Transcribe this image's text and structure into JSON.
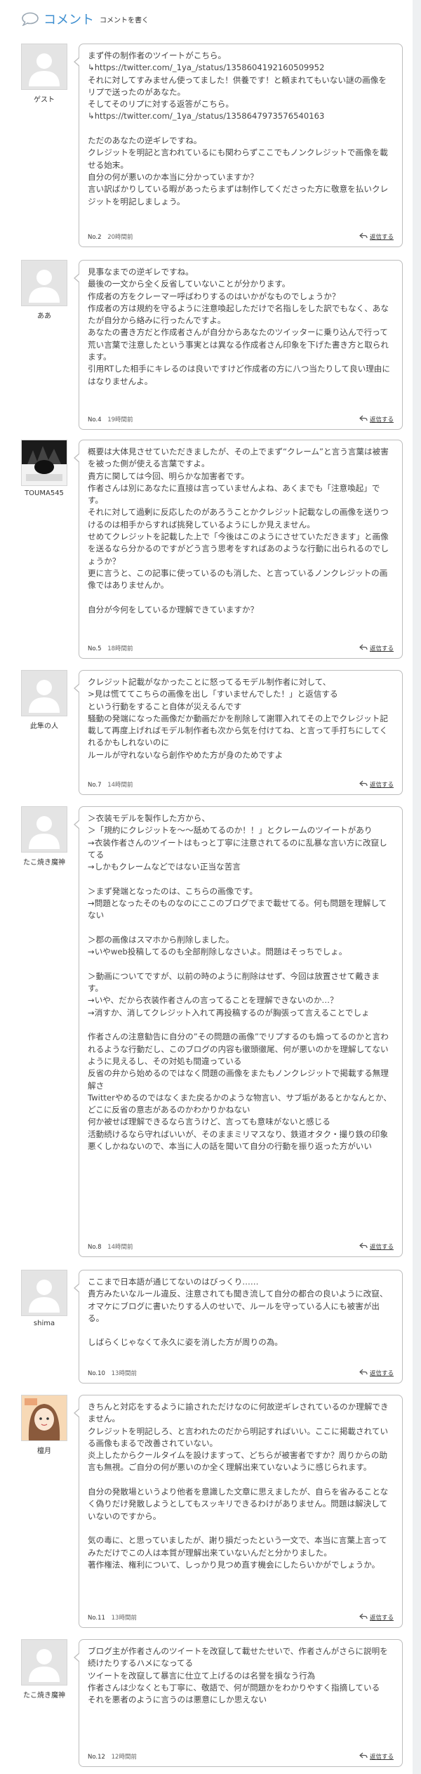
{
  "header": {
    "title": "コメント",
    "write_link": "コメントを書く",
    "accent_color": "#3e8fd0"
  },
  "reply_icon": "reply-arrow-icon",
  "comments": [
    {
      "author": "ゲスト",
      "avatar": "default-avatar",
      "no": "No.2",
      "time": "20時間前",
      "reply": "返信する",
      "body": "まず件の制作者のツイートがこちら。\n↳https://twitter.com/_1ya_/status/1358604192160509952\nそれに対してすみません使ってました！供養です！と頼まれてもいない謎の画像をリプで送ったのがあなた。\nそしてそのリプに対する返答がこちら。\n↳https://twitter.com/_1ya_/status/1358647973576540163\n\nただのあなたの逆ギレですね。\nクレジットを明記と言われているにも関わらずここでもノンクレジットで画像を載せる始末。\n自分の何が悪いのか本当に分かっていますか？\n言い訳ばかりしている暇があったらまずは制作してくださった方に敬意を払いクレジットを明記しましょう。"
    },
    {
      "author": "ああ",
      "avatar": "default-avatar",
      "no": "No.4",
      "time": "19時間前",
      "reply": "返信する",
      "body": "見事なまでの逆ギレですね。\n最後の一文から全く反省していないことが分かります。\n作成者の方をクレーマー呼ばわりするのはいかがなものでしょうか？\n作成者の方は規約を守るように注意喚起しただけで名指しをした訳でもなく、あなたが自分から絡みに行ったんですよ。\nあなたの書き方だと作成者さんが自分からあなたのツイッターに乗り込んで行って荒い言葉で注意したという事実とは異なる作成者さん印象を下げた書き方と取られます。\n引用RTした相手にキレるのは良いですけど作成者の方に八つ当たりして良い理由にはなりませんよ。"
    },
    {
      "author": "TOUMA545",
      "avatar": "photo-avatar",
      "no": "No.5",
      "time": "18時間前",
      "reply": "返信する",
      "body": "概要は大体見させていただきましたが、その上でまず“クレーム”と言う言葉は被害を被った側が使える言葉ですよ。\n貴方に関しては今回、明らかな加害者です。\n作者さんは別にあなたに直接は言っていませんよね、あくまでも「注意喚起」です。\nそれに対して過剰に反応したのがあろうことかクレジット記載なしの画像を送りつけるのは相手からすれば挑発しているようにしか見えません。\nせめてクレジットを記載した上で「今後はこのようにさせていただきます」と画像を送るなら分かるのですがどう言う思考をすればあのような行動に出られるのでしょうか？\n更に言うと、この記事に使っているのも消した、と言っているノンクレジットの画像ではありませんか。\n\n自分が今何をしているか理解できていますか？"
    },
    {
      "author": "此隼の人",
      "avatar": "default-avatar",
      "no": "No.7",
      "time": "14時間前",
      "reply": "返信する",
      "body": "クレジット記載がなかったことに怒ってるモデル制作者に対して、\n>見は慌ててこちらの画像を出し「すいませんでした！」と返信する\nという行動をすること自体が災えるんです\n騒動の発端になった画像だか動画だかを削除して謝罪入れてその上でクレジット記載して再度上げればモデル制作者も次から気を付けてね、と言って手打ちにしてくれるかもしれないのに\nルールが守れないなら創作やめた方が身のためですよ"
    },
    {
      "author": "たこ焼き魔神",
      "avatar": "default-avatar",
      "no": "No.8",
      "time": "14時間前",
      "reply": "返信する",
      "body": "＞衣装モデルを製作した方から、\n＞「規約にクレジットを〜〜舐めてるのか！！」とクレームのツイートがあり\n→衣装作者さんのツイートはもっと丁寧に注意されてるのに乱暴な言い方に改竄してる\n→しかもクレームなどではない正当な苦言\n\n＞まず発端となったのは、こちらの画像です。\n→問題となったそのものなのにここのブログでまで載せてる。何も問題を理解してない\n\n＞郡の画像はスマホから削除しました。\n→いやweb投稿してるのも全部削除しなさいよ。問題はそっちでしょ。\n\n＞動画についてですが、以前の時のように削除はせず、今回は放置させて戴きます。\n→いや、だから衣装作者さんの言ってることを理解できないのか…？\n→消すか、消してクレジット入れて再投稿するのが胸張って言えることでしょ\n\n作者さんの注意勧告に自分の”その問題の画像”でリプするのも煽ってるのかと言われるような行動だし、このブログの内容も徹頭徹尾、何が悪いのかを理解してないように見えるし、その対処も間違っている\n反省の弁から始めるのではなく問題の画像をまたもノンクレジットで掲載する無理解さ\nTwitterやめるのではなくまた戻るかのような物言い、サブ垢があるとかなんとか、どこに反省の意志があるのかわかりかねない\n何か被せば理解できるなら言うけど、言っても意味がないと感じる\n活動続けるなら守ればいいが、そのままミリマスなり、鉄道オタク・撮り鉄の印象悪くしかねないので、本当に人の話を聞いて自分の行動を振り返った方がいい"
    },
    {
      "author": "shima",
      "avatar": "default-avatar",
      "no": "No.10",
      "time": "13時間前",
      "reply": "返信する",
      "body": "ここまで日本語が通じてないのはびっくり……\n貴方みたいなルール違反、注意されても聞き流して自分の都合の良いように改竄、オマケにブログに書いたりする人のせいで、ルールを守っている人にも被害が出る。\n\nしばらくじゃなくて永久に姿を消した方が周りの為。"
    },
    {
      "author": "檀月",
      "avatar": "illustration-avatar",
      "no": "No.11",
      "time": "13時間前",
      "reply": "返信する",
      "body": "きちんと対応をするように諭されただけなのに何故逆ギレされているのか理解できません。\nクレジットを明記しろ、と言われたのだから明記すればいい。ここに掲載されている画像もまるで改善されていない。\n炎上したからクールタイムを設けますって、どちらが被害者ですか？周りからの助言も無視。ご自分の何が悪いのか全く理解出来ていないように感じられます。\n\n自分の発散場というより他者を意識した文章に思えましたが、自らを省みることなく偽りだけ発散しようとしてもスッキリできるわけがありません。問題は解決していないのですから。\n\n気の毒に、と思っていましたが、謝り損だったという一文で、本当に言葉上言ってみただけでこの人は本質が理解出来ていないんだと分かりました。\n著作権法、権利について、しっかり見つめ直す機会にしたらいかがでしょうか。"
    },
    {
      "author": "たこ焼き魔神",
      "avatar": "default-avatar",
      "no": "No.12",
      "time": "12時間前",
      "reply": "返信する",
      "body": "ブログ主が作者さんのツイートを改竄して載せたせいで、作者さんがさらに説明を続けたりするハメになってる\nツイートを改竄して暴言に仕立て上げるのは名誉を損なう行為\n作者さんは少なくとも丁寧に、敬語で、何が問題かをわかりやすく指摘している\nそれを悪者のように言うのは悪意にしか思えない"
    }
  ]
}
